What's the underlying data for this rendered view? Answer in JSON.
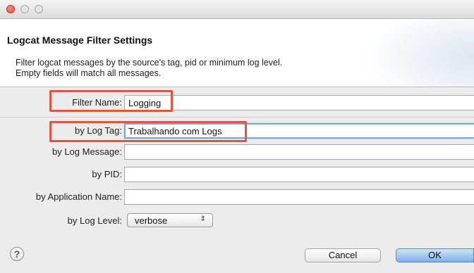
{
  "window": {
    "controls": [
      "close",
      "minimize",
      "maximize"
    ]
  },
  "header": {
    "title": "Logcat Message Filter Settings",
    "description_line1": "Filter logcat messages by the source's tag, pid or minimum log level.",
    "description_line2": "Empty fields will match all messages."
  },
  "form": {
    "filter_name": {
      "label": "Filter Name:",
      "value": "Logging"
    },
    "log_tag": {
      "label": "by Log Tag:",
      "value": "Trabalhando com Logs"
    },
    "log_message": {
      "label": "by Log Message:",
      "value": ""
    },
    "pid": {
      "label": "by PID:",
      "value": ""
    },
    "app_name": {
      "label": "by Application Name:",
      "value": ""
    },
    "log_level": {
      "label": "by Log Level:",
      "selected": "verbose",
      "arrows": "⇕"
    }
  },
  "footer": {
    "help_symbol": "?",
    "cancel_label": "Cancel",
    "ok_label": "OK"
  },
  "colors": {
    "highlight": "#e25543",
    "focus": "#7aa6d8",
    "ok_button": "#7fb1ea"
  }
}
